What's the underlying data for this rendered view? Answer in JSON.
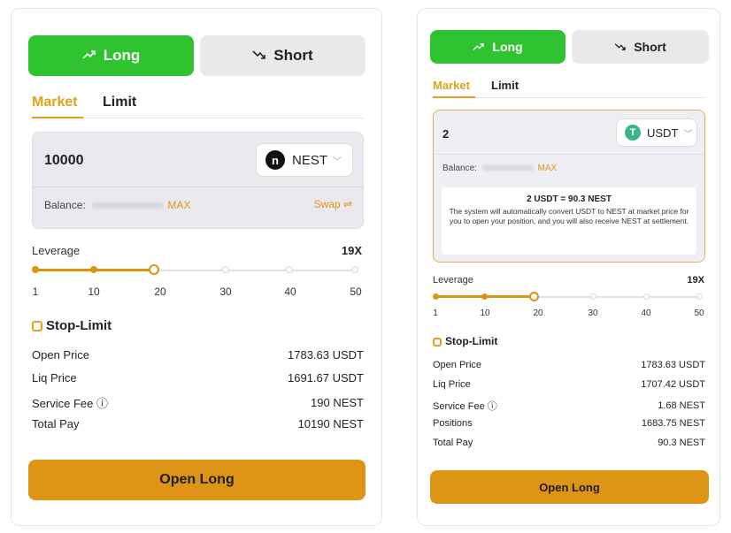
{
  "left": {
    "tabs": {
      "long": "Long",
      "short": "Short"
    },
    "order_types": {
      "market": "Market",
      "limit": "Limit"
    },
    "amount": "10000",
    "token": "NEST",
    "balance_label": "Balance:",
    "max_label": "MAX",
    "swap_label": "Swap ⇌",
    "leverage_label": "Leverage",
    "leverage_value": "19X",
    "leverage_ticks": [
      "1",
      "10",
      "20",
      "30",
      "40",
      "50"
    ],
    "stop_limit_label": "Stop-Limit",
    "rows": [
      {
        "label": "Open Price",
        "value": "1783.63 USDT"
      },
      {
        "label": "Liq Price",
        "value": "1691.67 USDT"
      },
      {
        "label": "Service Fee ⓘ",
        "value": "190 NEST"
      },
      {
        "label": "Total Pay",
        "value": "10190 NEST"
      }
    ],
    "open_button": "Open Long"
  },
  "right": {
    "tabs": {
      "long": "Long",
      "short": "Short"
    },
    "order_types": {
      "market": "Market",
      "limit": "Limit"
    },
    "amount": "2",
    "token": "USDT",
    "balance_label": "Balance:",
    "max_label": "MAX",
    "conversion_title": "2 USDT = 90.3 NEST",
    "conversion_text": "The system will automatically convert USDT to NEST at market price for you to open your position, and you will also receive NEST at settlement.",
    "leverage_label": "Leverage",
    "leverage_value": "19X",
    "leverage_ticks": [
      "1",
      "10",
      "20",
      "30",
      "40",
      "50"
    ],
    "stop_limit_label": "Stop-Limit",
    "rows": [
      {
        "label": "Open Price",
        "value": "1783.63 USDT"
      },
      {
        "label": "Liq Price",
        "value": "1707.42 USDT"
      },
      {
        "label": "Service Fee ⓘ",
        "value": "1.68 NEST"
      },
      {
        "label": "Positions",
        "value": "1683.75 NEST"
      },
      {
        "label": "Total Pay",
        "value": "90.3 NEST"
      }
    ],
    "open_button": "Open Long"
  },
  "colors": {
    "long_green": "#2fc42f",
    "accent_orange": "#de9415",
    "short_gray": "#e9e9ec"
  },
  "icons": {
    "long": "trend-up-icon",
    "short": "trend-down-icon",
    "nest": "nest-coin-icon",
    "usdt": "usdt-coin-icon"
  }
}
